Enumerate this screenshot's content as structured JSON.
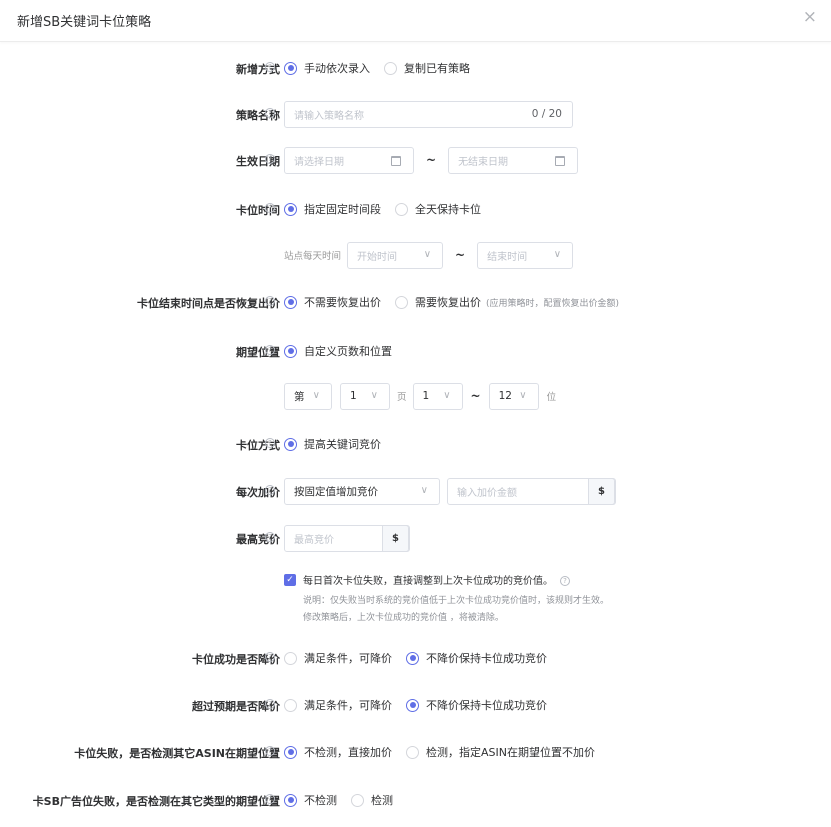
{
  "dialog": {
    "title": "新增SB关键词卡位策略",
    "close_icon": "×"
  },
  "help_glyph": "?",
  "add_mode": {
    "label": "新增方式",
    "options": [
      "手动依次录入",
      "复制已有策略"
    ],
    "selected": 0
  },
  "strategy_name": {
    "label": "策略名称",
    "placeholder": "请输入策略名称",
    "counter": "0 / 20"
  },
  "effective_date": {
    "label": "生效日期",
    "start_placeholder": "请选择日期",
    "end_placeholder": "无结束日期",
    "separator": "~"
  },
  "slot_time": {
    "label": "卡位时间",
    "options": [
      "指定固定时间段",
      "全天保持卡位"
    ],
    "selected": 0
  },
  "site_daily_time": {
    "label": "站点每天时间",
    "start_placeholder": "开始时间",
    "end_placeholder": "结束时间",
    "separator": "~"
  },
  "restore_bid": {
    "label": "卡位结束时间点是否恢复出价",
    "options": [
      "不需要恢复出价",
      "需要恢复出价"
    ],
    "note": "(应用策略时，配置恢复出价金额)",
    "selected": 0
  },
  "target_position": {
    "label": "期望位置",
    "options": [
      "自定义页数和位置"
    ],
    "selected": 0,
    "prefix": "第",
    "page_value": "1",
    "page_unit": "页",
    "pos_from": "1",
    "separator": "~",
    "pos_to": "12",
    "pos_unit": "位"
  },
  "slot_method": {
    "label": "卡位方式",
    "options": [
      "提高关键词竞价"
    ],
    "selected": 0
  },
  "bid_increment": {
    "label": "每次加价",
    "mode_value": "按固定值增加竞价",
    "amount_placeholder": "输入加价金额",
    "currency": "$"
  },
  "max_bid": {
    "label": "最高竞价",
    "placeholder": "最高竞价",
    "currency": "$"
  },
  "daily_first_fail": {
    "checked": true,
    "check_glyph": "✓",
    "text": "每日首次卡位失败，直接调整到上次卡位成功的竞价值。",
    "note_line1": "说明：仅失败当时系统的竞价值低于上次卡位成功竞价值时，该规则才生效。",
    "note_line2": "修改策略后，上次卡位成功的竞价值 ，将被清除。"
  },
  "success_lower": {
    "label": "卡位成功是否降价",
    "options": [
      "满足条件，可降价",
      "不降价保持卡位成功竞价"
    ],
    "selected": 1
  },
  "over_lower": {
    "label": "超过预期是否降价",
    "options": [
      "满足条件，可降价",
      "不降价保持卡位成功竞价"
    ],
    "selected": 1
  },
  "fail_check_asin": {
    "label": "卡位失败，是否检测其它ASIN在期望位置",
    "options": [
      "不检测，直接加价",
      "检测，指定ASIN在期望位置不加价"
    ],
    "selected": 0
  },
  "fail_check_type": {
    "label": "卡SB广告位失败，是否检测在其它类型的期望位置",
    "options": [
      "不检测",
      "检测"
    ],
    "selected": 0
  },
  "colors": {
    "accent": "#5f6ee6",
    "text": "#303133",
    "muted": "#909399",
    "border": "#dcdfe6"
  }
}
